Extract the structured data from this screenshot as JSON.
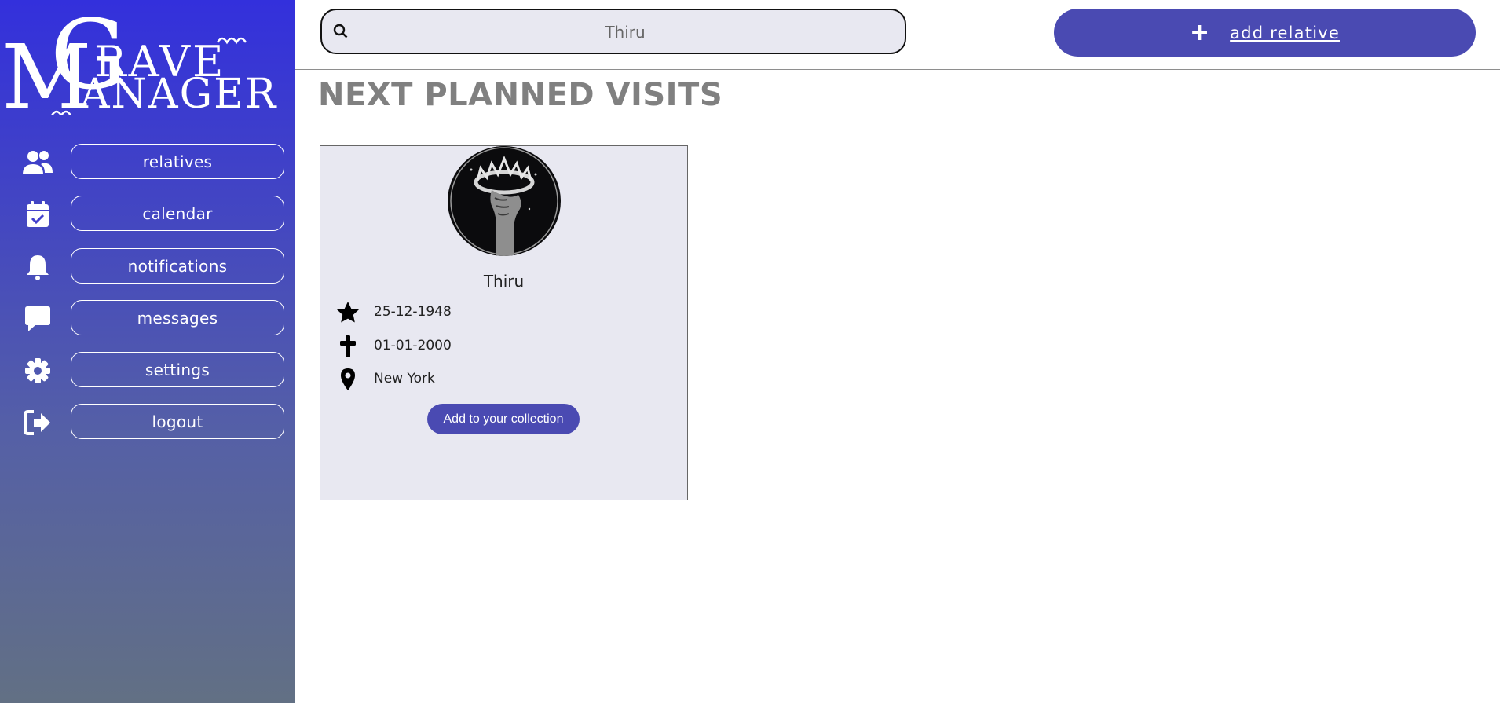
{
  "app": {
    "logo_text": "Grave Manager",
    "colors": {
      "accent": "#4a4ab2",
      "sidebar_top": "#3330dc",
      "sidebar_bottom": "#627084"
    }
  },
  "sidebar": {
    "items": [
      {
        "label": "relatives",
        "icon": "users-icon"
      },
      {
        "label": "calendar",
        "icon": "calendar-check-icon"
      },
      {
        "label": "notifications",
        "icon": "bell-icon"
      },
      {
        "label": "messages",
        "icon": "message-icon"
      },
      {
        "label": "settings",
        "icon": "gear-icon"
      },
      {
        "label": "logout",
        "icon": "logout-icon"
      }
    ]
  },
  "header": {
    "search": {
      "value": "",
      "placeholder": "Thiru"
    },
    "add_relative": {
      "plus": "+",
      "label": "add relative"
    }
  },
  "main": {
    "title": "NEXT PLANNED VISITS",
    "card": {
      "name": "Thiru",
      "birth_date": "25-12-1948",
      "death_date": "01-01-2000",
      "location": "New York",
      "button_label": "Add to your collection"
    }
  }
}
